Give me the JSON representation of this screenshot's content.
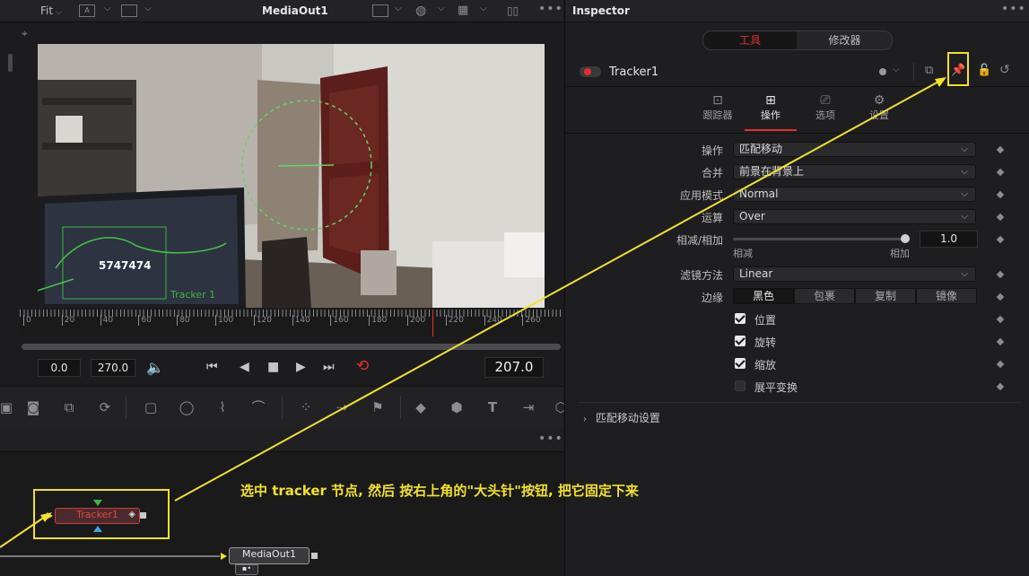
{
  "viewer": {
    "fit_label": "Fit",
    "title": "MediaOut1",
    "time_start": "0.0",
    "time_end": "270.0",
    "current_frame": "207.0",
    "timeline_ticks": [
      "0",
      "20",
      "40",
      "60",
      "80",
      "100",
      "120",
      "140",
      "160",
      "180",
      "200",
      "220",
      "240",
      "260"
    ],
    "overlay_number": "5747474",
    "overlay_tracker_label": "Tracker 1"
  },
  "inspector": {
    "title": "Inspector",
    "top_tabs": [
      "工具",
      "修改器"
    ],
    "node_name": "Tracker1",
    "sub_tabs": [
      {
        "label": "跟踪器",
        "icon": "tracker-icon"
      },
      {
        "label": "操作",
        "icon": "operation-icon"
      },
      {
        "label": "选项",
        "icon": "options-icon"
      },
      {
        "label": "设置",
        "icon": "settings-icon"
      }
    ],
    "rows": {
      "operation": {
        "label": "操作",
        "value": "匹配移动"
      },
      "merge": {
        "label": "合并",
        "value": "前景在背景上"
      },
      "apply_mode": {
        "label": "应用模式",
        "value": "Normal"
      },
      "operator": {
        "label": "运算",
        "value": "Over"
      },
      "subtractive_additive": {
        "label": "相减/相加",
        "value": "1.0",
        "left": "相减",
        "right": "相加"
      },
      "filter_method": {
        "label": "滤镜方法",
        "value": "Linear"
      },
      "edges": {
        "label": "边缘",
        "options": [
          "黑色",
          "包裹",
          "复制",
          "镜像"
        ]
      }
    },
    "checkboxes": [
      {
        "label": "位置",
        "checked": true
      },
      {
        "label": "旋转",
        "checked": true
      },
      {
        "label": "缩放",
        "checked": true
      },
      {
        "label": "展平变换",
        "checked": false
      }
    ],
    "section": "匹配移动设置"
  },
  "nodes": {
    "tracker": "Tracker1",
    "media_out": "MediaOut1"
  },
  "annotation": "选中 tracker 节点, 然后 按右上角的\"大头针\"按钮, 把它固定下来",
  "colors": {
    "accent_red": "#e0312f",
    "annotation_yellow": "#f1e22b"
  }
}
